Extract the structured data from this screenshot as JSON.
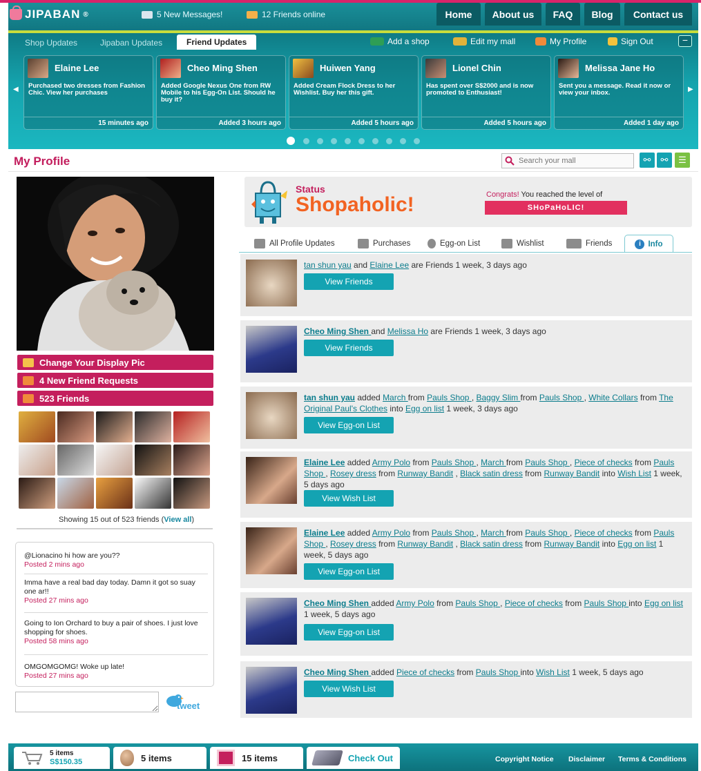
{
  "header": {
    "logo_text": "JIPABAN",
    "messages": "5 New Messages!",
    "friends_online": "12 Friends online",
    "nav": [
      "Home",
      "About us",
      "FAQ",
      "Blog",
      "Contact us"
    ]
  },
  "subnav": {
    "tabs": [
      "Shop Updates",
      "Jipaban Updates",
      "Friend Updates"
    ],
    "active_tab": "Friend Updates",
    "actions": [
      "Add a shop",
      "Edit my mall",
      "My Profile",
      "Sign Out"
    ],
    "minimize": "−"
  },
  "friend_updates": [
    {
      "name": "Elaine Lee",
      "text": "Purchased two dresses from Fashion Chic. View her purchases",
      "time": "15 minutes ago"
    },
    {
      "name": "Cheo Ming Shen",
      "text": "Added Google Nexus One from RW Mobile to his Egg-On List. Should he buy it?",
      "time": "Added 3 hours ago"
    },
    {
      "name": "Huiwen Yang",
      "text": "Added Cream Flock Dress to her Wishlist. Buy her this gift.",
      "time": "Added 5 hours ago"
    },
    {
      "name": "Lionel Chin",
      "text": "Has spent over S$2000 and is now promoted to Enthusiast!",
      "time": "Added 5 hours ago"
    },
    {
      "name": "Melissa Jane Ho",
      "text": "Sent you a message. Read it now or view your inbox.",
      "time": "Added 1 day ago"
    }
  ],
  "carousel": {
    "left_arrow": "◀",
    "right_arrow": "▶",
    "pages": 10,
    "current": 1
  },
  "profile": {
    "title": "My Profile",
    "search_placeholder": "Search your mall",
    "buttons": [
      "Change Your Display Pic",
      "4 New Friend Requests",
      "523 Friends"
    ],
    "showing_text": "Showing 15 out of 523 friends (",
    "view_all": "View all",
    "showing_close": ")"
  },
  "tweets": [
    {
      "text": "@Lionacino hi how are you??",
      "ago": "Posted 2 mins ago"
    },
    {
      "text": "Imma have a real bad day today. Damn it got so suay one ar!!",
      "ago": "Posted 27 mins ago"
    },
    {
      "text": "Going to Ion Orchard to buy a pair of shoes. I just love shopping for shoes.",
      "ago": "Posted 58 mins ago"
    },
    {
      "text": "OMGOMGOMG!  Woke up late!",
      "ago": "Posted 27 mins ago"
    }
  ],
  "tweet_button": "tweet",
  "status": {
    "label": "Status",
    "value": "Shopaholic!",
    "congrats_prefix": "Congrats!",
    "congrats_text": " You reached the level of",
    "level": "SHoPaHoLIC!"
  },
  "profile_tabs": [
    "All Profile Updates",
    "Purchases",
    "Egg-on List",
    "Wishlist",
    "Friends",
    "Info"
  ],
  "feed": [
    {
      "parts": [
        [
          "l",
          "tan shun yau"
        ],
        [
          "t",
          " and "
        ],
        [
          "l",
          "Elaine Lee"
        ],
        [
          "t",
          " are Friends 1 week, 3 days ago"
        ]
      ],
      "button": "View Friends"
    },
    {
      "parts": [
        [
          "b",
          "Cheo Ming Shen "
        ],
        [
          "t",
          "and "
        ],
        [
          "l",
          "Melissa Ho"
        ],
        [
          "t",
          " are Friends 1 week, 3 days ago"
        ]
      ],
      "button": "View Friends"
    },
    {
      "parts": [
        [
          "b",
          "tan shun yau"
        ],
        [
          "t",
          " added "
        ],
        [
          "l",
          "March "
        ],
        [
          "t",
          "from "
        ],
        [
          "l",
          "Pauls Shop "
        ],
        [
          "t",
          ", "
        ],
        [
          "l",
          "Baggy Slim "
        ],
        [
          "t",
          "from "
        ],
        [
          "l",
          "Pauls Shop "
        ],
        [
          "t",
          ", "
        ],
        [
          "l",
          "White Collars"
        ],
        [
          "t",
          " from "
        ],
        [
          "l",
          "The Original Paul's Clothes"
        ],
        [
          "t",
          " into "
        ],
        [
          "l",
          "Egg on list"
        ],
        [
          "t",
          " 1 week, 3 days ago"
        ]
      ],
      "button": "View Egg-on List"
    },
    {
      "parts": [
        [
          "b",
          "Elaine Lee"
        ],
        [
          "t",
          " added "
        ],
        [
          "l",
          "Army Polo"
        ],
        [
          "t",
          " from "
        ],
        [
          "l",
          "Pauls Shop "
        ],
        [
          "t",
          ", "
        ],
        [
          "l",
          "March "
        ],
        [
          "t",
          "from "
        ],
        [
          "l",
          "Pauls Shop "
        ],
        [
          "t",
          ", "
        ],
        [
          "l",
          "Piece of checks"
        ],
        [
          "t",
          " from "
        ],
        [
          "l",
          "Pauls Shop "
        ],
        [
          "t",
          ", "
        ],
        [
          "l",
          "Rosey dress"
        ],
        [
          "t",
          " from "
        ],
        [
          "l",
          "Runway Bandit"
        ],
        [
          "t",
          " , "
        ],
        [
          "l",
          "Black satin dress"
        ],
        [
          "t",
          " from "
        ],
        [
          "l",
          "Runway Bandit"
        ],
        [
          "t",
          " into "
        ],
        [
          "l",
          "Wish List"
        ],
        [
          "t",
          " 1 week, 5 days ago"
        ]
      ],
      "button": "View Wish List"
    },
    {
      "parts": [
        [
          "b",
          "Elaine Lee"
        ],
        [
          "t",
          " added "
        ],
        [
          "l",
          "Army Polo"
        ],
        [
          "t",
          " from "
        ],
        [
          "l",
          "Pauls Shop "
        ],
        [
          "t",
          ", "
        ],
        [
          "l",
          "March "
        ],
        [
          "t",
          "from "
        ],
        [
          "l",
          "Pauls Shop "
        ],
        [
          "t",
          ", "
        ],
        [
          "l",
          "Piece of checks"
        ],
        [
          "t",
          " from "
        ],
        [
          "l",
          "Pauls Shop "
        ],
        [
          "t",
          ", "
        ],
        [
          "l",
          "Rosey dress"
        ],
        [
          "t",
          " from "
        ],
        [
          "l",
          "Runway Bandit"
        ],
        [
          "t",
          " , "
        ],
        [
          "l",
          "Black satin dress"
        ],
        [
          "t",
          " from "
        ],
        [
          "l",
          "Runway Bandit"
        ],
        [
          "t",
          " into "
        ],
        [
          "l",
          "Egg on list"
        ],
        [
          "t",
          " 1 week, 5 days ago"
        ]
      ],
      "button": "View Egg-on List"
    },
    {
      "parts": [
        [
          "b",
          "Cheo Ming Shen "
        ],
        [
          "t",
          "added "
        ],
        [
          "l",
          "Army Polo"
        ],
        [
          "t",
          " from "
        ],
        [
          "l",
          "Pauls Shop "
        ],
        [
          "t",
          ", "
        ],
        [
          "l",
          "Piece of checks"
        ],
        [
          "t",
          " from "
        ],
        [
          "l",
          "Pauls Shop "
        ],
        [
          "t",
          "into "
        ],
        [
          "l",
          "Egg on list"
        ],
        [
          "t",
          " 1 week, 5 days ago"
        ]
      ],
      "button": "View Egg-on List"
    },
    {
      "parts": [
        [
          "b",
          "Cheo Ming Shen "
        ],
        [
          "t",
          "added "
        ],
        [
          "l",
          "Piece of checks"
        ],
        [
          "t",
          " from "
        ],
        [
          "l",
          "Pauls Shop "
        ],
        [
          "t",
          "into "
        ],
        [
          "l",
          "Wish List"
        ],
        [
          "t",
          " 1 week, 5 days ago"
        ]
      ],
      "button": "View Wish List"
    }
  ],
  "footer": {
    "cart_items": "5 items",
    "cart_total": "S$150.35",
    "egg_items": "5 items",
    "wish_items": "15 items",
    "checkout": "Check Out",
    "links": [
      "Copyright Notice",
      "Disclaimer",
      "Terms & Conditions"
    ]
  },
  "colors": {
    "brand_pink": "#c41f5d",
    "teal": "#14a3b2",
    "accent_orange": "#f26322"
  }
}
